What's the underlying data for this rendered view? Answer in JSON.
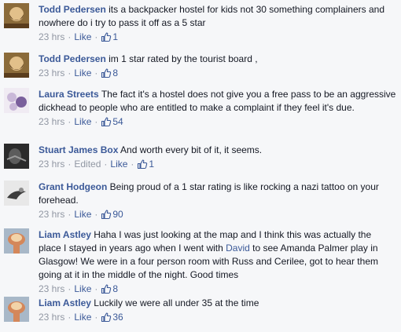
{
  "comments": [
    {
      "author": "Todd Pedersen",
      "parts": [
        {
          "t": "its a backpacker hostel for kids not 30 something complainers and nowhere do i try to pass it off as a 5 star"
        }
      ],
      "time": "23 hrs",
      "edited": "",
      "like_label": "Like",
      "likes": "1",
      "avatar_icon": "person-beard-avatar",
      "avatar_colors": [
        "#8b6b3a",
        "#e2c08a",
        "#5a3d1d"
      ]
    },
    {
      "author": "Todd Pedersen",
      "parts": [
        {
          "t": "im 1 star rated by the tourist board ,"
        }
      ],
      "time": "23 hrs",
      "edited": "",
      "like_label": "Like",
      "likes": "8",
      "avatar_icon": "person-beard-avatar",
      "avatar_colors": [
        "#8b6b3a",
        "#e2c08a",
        "#5a3d1d"
      ]
    },
    {
      "author": "Laura Streets",
      "parts": [
        {
          "t": "The fact it's a hostel does not give you a free pass to be an aggressive dickhead to people who are entitled to make a complaint if they feel it's due."
        }
      ],
      "time": "23 hrs",
      "edited": "",
      "like_label": "Like",
      "likes": "54",
      "avatar_icon": "flowers-avatar",
      "avatar_colors": [
        "#c9b8d8",
        "#7a5f9c",
        "#f0ebf3"
      ]
    },
    {
      "author": "Stuart James Box",
      "parts": [
        {
          "t": "And worth every bit of it, it seems."
        }
      ],
      "time": "23 hrs",
      "edited": "Edited",
      "like_label": "Like",
      "likes": "1",
      "avatar_icon": "dark-portrait-avatar",
      "avatar_colors": [
        "#2b2b2b",
        "#9a9a9a",
        "#5c5c5c"
      ]
    },
    {
      "author": "Grant Hodgeon",
      "parts": [
        {
          "t": "Being proud of a 1 star rating is like rocking a nazi tattoo on your forehead."
        }
      ],
      "time": "23 hrs",
      "edited": "",
      "like_label": "Like",
      "likes": "90",
      "avatar_icon": "bird-avatar",
      "avatar_colors": [
        "#e8e8e8",
        "#3d3d3d",
        "#8e8e8e"
      ]
    },
    {
      "author": "Liam Astley",
      "parts": [
        {
          "t": "Haha I was just looking at the map and I think this was actually the place I stayed in years ago when I went with "
        },
        {
          "t": "David",
          "link": true
        },
        {
          "t": " to see Amanda Palmer play in Glasgow! We were in a four person room with Russ and Cerilee, got to hear them going at it in the middle of the night. Good times"
        }
      ],
      "time": "23 hrs",
      "edited": "",
      "like_label": "Like",
      "likes": "8",
      "avatar_icon": "explosion-avatar",
      "avatar_colors": [
        "#a8b8c8",
        "#d4875a",
        "#f2d3a8"
      ]
    },
    {
      "author": "Liam Astley",
      "parts": [
        {
          "t": "Luckily we were all under 35 at the time"
        }
      ],
      "time": "23 hrs",
      "edited": "",
      "like_label": "Like",
      "likes": "36",
      "avatar_icon": "explosion-avatar",
      "avatar_colors": [
        "#a8b8c8",
        "#d4875a",
        "#f2d3a8"
      ]
    }
  ],
  "meta_separator": "·",
  "like_icon": "thumbs-up-icon"
}
